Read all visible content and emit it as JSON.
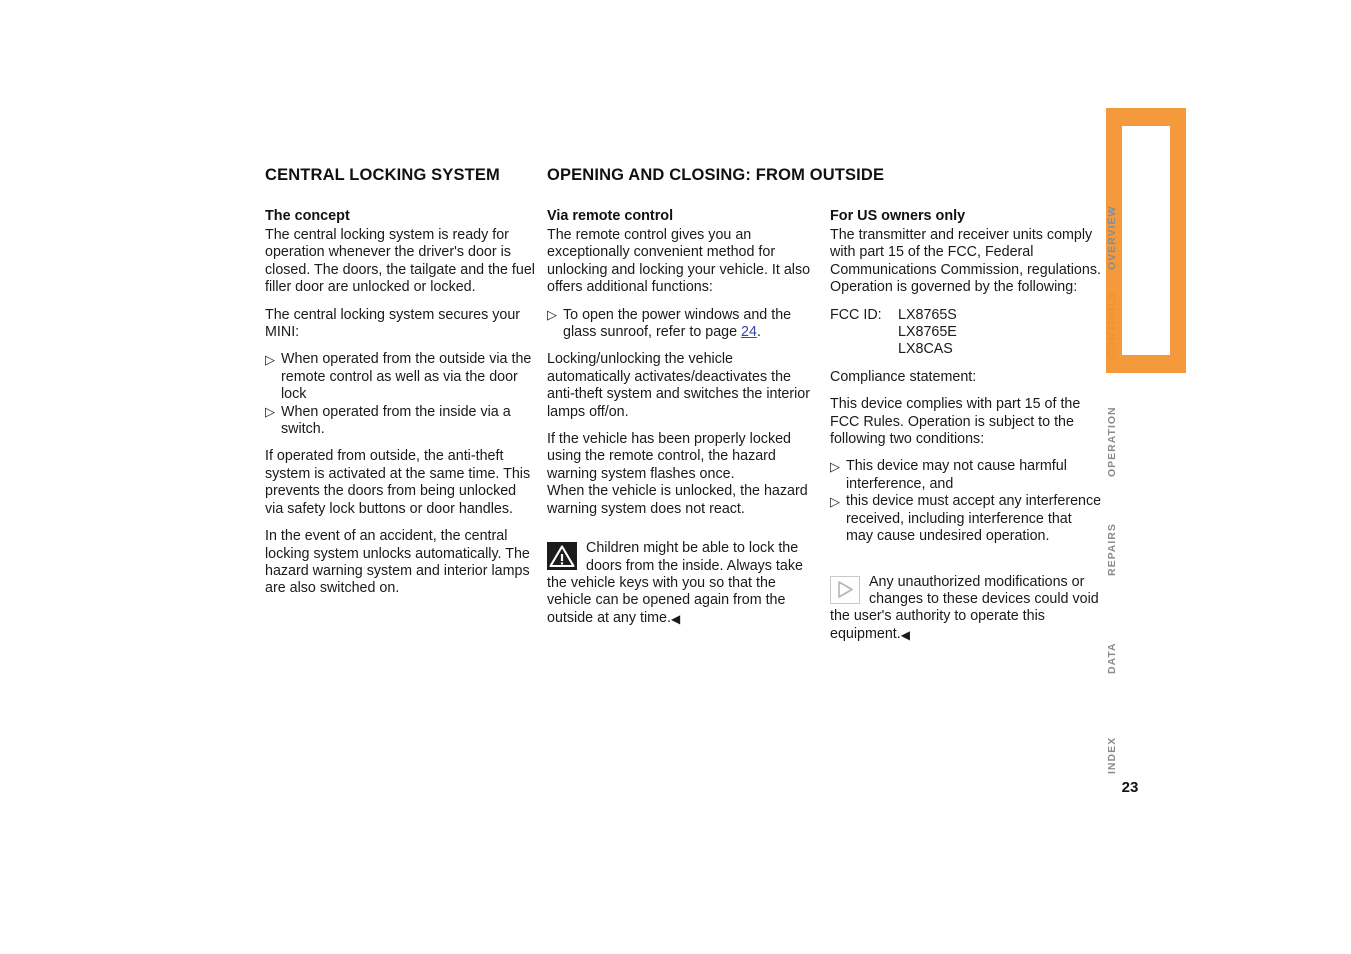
{
  "page": {
    "number": "23",
    "accent_color": "#f49a3c",
    "link_color": "#3a46a8"
  },
  "headings": {
    "left_title": "CENTRAL LOCKING SYSTEM",
    "right_title": "OPENING AND CLOSING: FROM OUTSIDE"
  },
  "column1": {
    "subheading": "The concept",
    "p1": "The central locking system is ready for operation whenever the driver's door is closed. The doors, the tailgate and the fuel filler door are unlocked or locked.",
    "p2": "The central locking system secures your MINI:",
    "bullets": [
      "When operated from the outside via the remote control as well as via the door lock",
      "When operated from the inside via a switch."
    ],
    "p3": "If operated from outside, the anti-theft system is activated at the same time. This prevents the doors from being unlocked via safety lock buttons or door handles.",
    "p4": "In the event of an accident, the central locking system unlocks automatically. The hazard warning system and interior lamps are also switched on."
  },
  "column2": {
    "subheading": "Via remote control",
    "p1": "The remote control gives you an exceptionally convenient method for unlocking and locking your vehicle. It also offers additional functions:",
    "bullet1_before": "To open the power windows and the glass sunroof, refer to page ",
    "bullet1_link": "24",
    "bullet1_after": ".",
    "p2": "Locking/unlocking the vehicle automatically activates/deactivates the anti-theft system and switches the interior lamps off/on.",
    "p3": "If the vehicle has been properly locked using the remote control, the hazard warning system flashes once.",
    "p4": "When the vehicle is unlocked, the hazard warning system does not react.",
    "warning": {
      "icon": "warning-triangle-icon",
      "text": "Children might be able to lock the doors from the inside. Always take the vehicle keys with you so that the vehicle can be opened again from the outside at any time.",
      "endmark": "◀"
    }
  },
  "column3": {
    "subheading": "For US owners only",
    "p1": "The transmitter and receiver units comply with part 15 of the FCC, Federal Communications Commission, regulations. Operation is governed by the following:",
    "fcc_label": "FCC ID:",
    "fcc_ids": [
      "LX8765S",
      "LX8765E",
      "LX8CAS"
    ],
    "p2": "Compliance statement:",
    "p3": "This device complies with part 15 of the FCC Rules. Operation is subject to the following two conditions:",
    "bullets": [
      "This device may not cause harmful interference, and",
      "this device must accept any interference received, including interference that may cause undesired operation."
    ],
    "note": {
      "icon": "note-triangle-icon",
      "text": "Any unauthorized modifications or changes to these devices could void the user's authority to operate this equipment.",
      "endmark": "◀"
    }
  },
  "tabs": [
    {
      "label": "OVERVIEW",
      "active": false
    },
    {
      "label": "CONTROLS",
      "active": true
    },
    {
      "label": "OPERATION",
      "active": false
    },
    {
      "label": "REPAIRS",
      "active": false
    },
    {
      "label": "DATA",
      "active": false
    },
    {
      "label": "INDEX",
      "active": false
    }
  ]
}
